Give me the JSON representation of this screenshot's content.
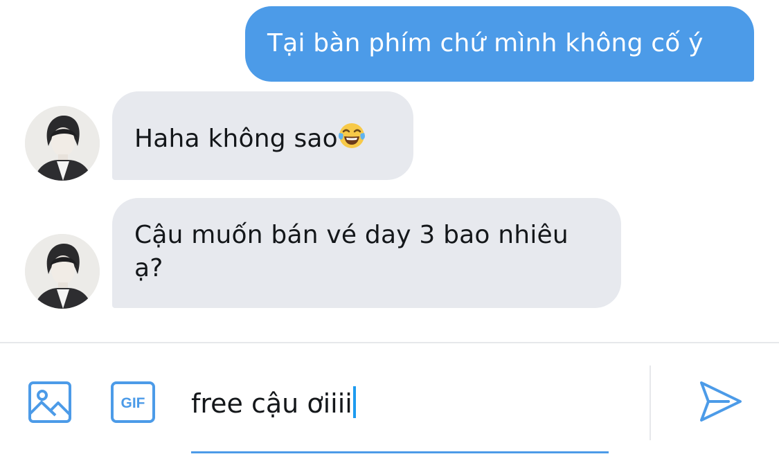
{
  "conversation": {
    "messages": [
      {
        "direction": "sent",
        "text": "Tại bàn phím chứ mình không cố ý"
      },
      {
        "direction": "received",
        "text": "Haha không sao",
        "emoji": "face-with-tears-of-joy"
      },
      {
        "direction": "received",
        "text": "Cậu muốn bán vé day 3 bao nhiêu ạ?"
      }
    ]
  },
  "composer": {
    "media_icon": "image-icon",
    "gif_label": "GIF",
    "input_value": "free cậu ơiiii",
    "send_icon": "send-icon"
  },
  "colors": {
    "accent": "#4c9be8",
    "sent_bubble": "#4c9be8",
    "received_bubble": "#e7e9ee",
    "text": "#14171a"
  }
}
